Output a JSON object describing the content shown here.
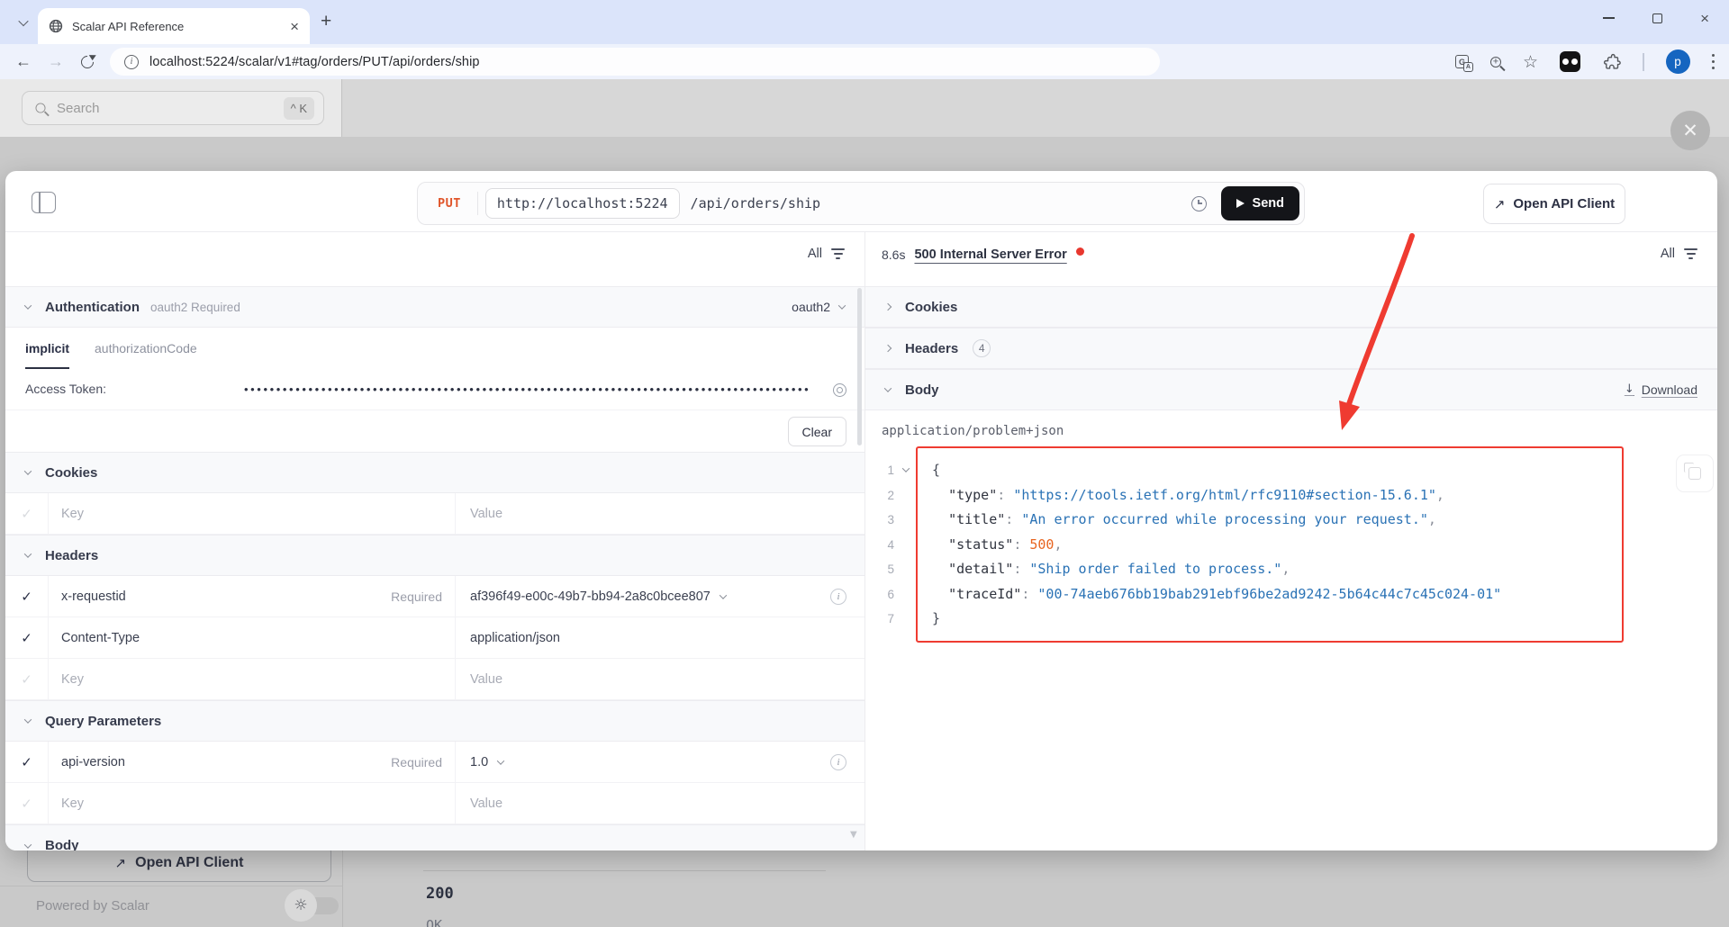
{
  "browser": {
    "tab_title": "Scalar API Reference",
    "url": "localhost:5224/scalar/v1#tag/orders/PUT/api/orders/ship",
    "profile_initial": "p"
  },
  "overlay": {
    "search_placeholder": "Search",
    "search_shortcut": "^ K"
  },
  "request_bar": {
    "method": "PUT",
    "server": "http://localhost:5224",
    "path": "/api/orders/ship",
    "send_label": "Send",
    "open_api_client_label": "Open API Client"
  },
  "request_panel": {
    "filter_label": "All",
    "auth": {
      "title": "Authentication",
      "subtitle": "oauth2 Required",
      "selected_scheme": "oauth2",
      "tab_implicit": "implicit",
      "tab_authorization_code": "authorizationCode",
      "access_token_label": "Access Token:",
      "access_token_masked": "••••••••••••••••••••••••••••••••••••••••••••••••••••••••••••••••••••••••••••••••••••••••",
      "clear_label": "Clear"
    },
    "cookies": {
      "title": "Cookies",
      "key_placeholder": "Key",
      "value_placeholder": "Value"
    },
    "headers": {
      "title": "Headers",
      "row1": {
        "key": "x-requestid",
        "required": "Required",
        "value": "af396f49-e00c-49b7-bb94-2a8c0bcee807"
      },
      "row2": {
        "key": "Content-Type",
        "value": "application/json"
      },
      "key_placeholder": "Key",
      "value_placeholder": "Value"
    },
    "query_params": {
      "title": "Query Parameters",
      "row1": {
        "key": "api-version",
        "required": "Required",
        "value": "1.0"
      },
      "key_placeholder": "Key",
      "value_placeholder": "Value"
    },
    "body": {
      "title": "Body"
    }
  },
  "response_panel": {
    "duration": "8.6s",
    "status": "500 Internal Server Error",
    "filter_label": "All",
    "cookies_title": "Cookies",
    "headers_title": "Headers",
    "headers_count": "4",
    "body_title": "Body",
    "download_label": "Download",
    "content_type": "application/problem+json",
    "code": {
      "lines": [
        [
          {
            "c": "brace",
            "t": "{"
          }
        ],
        [
          {
            "c": "ind",
            "t": "  "
          },
          {
            "c": "key",
            "t": "\"type\""
          },
          {
            "c": "punc",
            "t": ": "
          },
          {
            "c": "str",
            "t": "\"https://tools.ietf.org/html/rfc9110#section-15.6.1\""
          },
          {
            "c": "punc",
            "t": ","
          }
        ],
        [
          {
            "c": "ind",
            "t": "  "
          },
          {
            "c": "key",
            "t": "\"title\""
          },
          {
            "c": "punc",
            "t": ": "
          },
          {
            "c": "str",
            "t": "\"An error occurred while processing your request.\""
          },
          {
            "c": "punc",
            "t": ","
          }
        ],
        [
          {
            "c": "ind",
            "t": "  "
          },
          {
            "c": "key",
            "t": "\"status\""
          },
          {
            "c": "punc",
            "t": ": "
          },
          {
            "c": "num",
            "t": "500"
          },
          {
            "c": "punc",
            "t": ","
          }
        ],
        [
          {
            "c": "ind",
            "t": "  "
          },
          {
            "c": "key",
            "t": "\"detail\""
          },
          {
            "c": "punc",
            "t": ": "
          },
          {
            "c": "str",
            "t": "\"Ship order failed to process.\""
          },
          {
            "c": "punc",
            "t": ","
          }
        ],
        [
          {
            "c": "ind",
            "t": "  "
          },
          {
            "c": "key",
            "t": "\"traceId\""
          },
          {
            "c": "punc",
            "t": ": "
          },
          {
            "c": "str",
            "t": "\"00-74aeb676bb19bab291ebf96be2ad9242-5b64c44c7c45c024-01\""
          }
        ],
        [
          {
            "c": "brace",
            "t": "}"
          }
        ]
      ]
    }
  },
  "background_page": {
    "open_api_client_label": "Open API Client",
    "powered_by": "Powered by Scalar",
    "status_code": "200",
    "status_text": "OK"
  },
  "colors": {
    "method_put": "#e0552b",
    "status_dot_red": "#e8372e",
    "annotation_red": "#ef3b31",
    "code_string_blue": "#2a72b5",
    "code_number_orange": "#e8641f",
    "send_button_bg": "#141519",
    "avatar_blue": "#1565c0"
  }
}
